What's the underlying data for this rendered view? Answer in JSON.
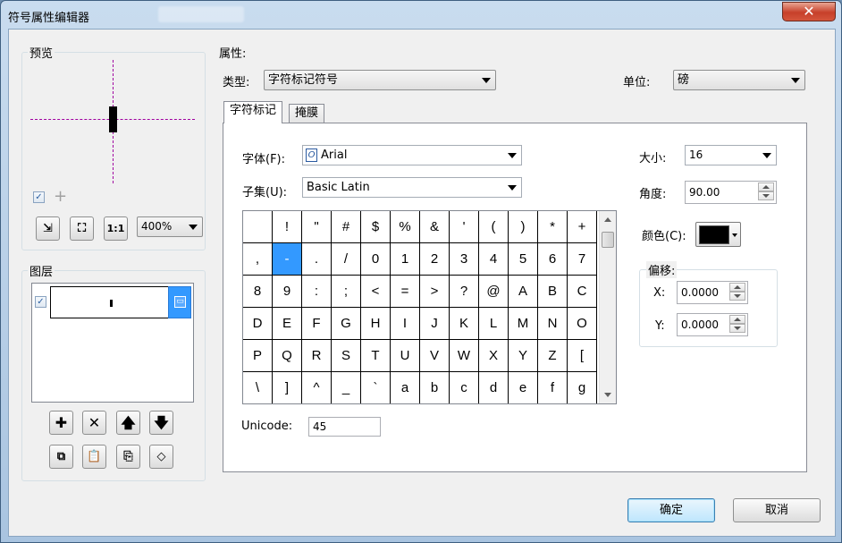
{
  "window": {
    "title": "符号属性编辑器",
    "close_glyph": "✕"
  },
  "preview": {
    "group_label": "预览",
    "show_checkbox_checked": true,
    "zoom_value": "400%",
    "buttons": [
      "zoom-to-fit-icon",
      "full-extent-icon",
      "actual-size-icon"
    ]
  },
  "layers": {
    "group_label": "图层",
    "row_checked": true,
    "action_buttons": [
      "add-icon",
      "remove-icon",
      "move-up-icon",
      "move-down-icon"
    ],
    "tool_buttons": [
      "copy-icon",
      "paste-icon",
      "reset-icon",
      "tag-icon"
    ]
  },
  "properties": {
    "group_label": "属性:",
    "type_label": "类型:",
    "type_value": "字符标记符号",
    "unit_label": "单位:",
    "unit_value": "磅",
    "tabs": [
      {
        "label": "字符标记",
        "active": true
      },
      {
        "label": "掩膜",
        "active": false
      }
    ],
    "font_label": "字体(F):",
    "font_value": "Arial",
    "subset_label": "子集(U):",
    "subset_value": "Basic Latin",
    "unicode_label": "Unicode:",
    "unicode_value": "45",
    "size_label": "大小:",
    "size_value": "16",
    "angle_label": "角度:",
    "angle_value": "90.00",
    "color_label": "颜色(C):",
    "color_value": "#000000",
    "offset_label": "偏移:",
    "x_label": "X:",
    "x_value": "0.0000",
    "y_label": "Y:",
    "y_value": "0.0000"
  },
  "char_grid": {
    "selected_index": 13,
    "chars": [
      "",
      "!",
      "\"",
      "#",
      "$",
      "%",
      "&",
      "'",
      "(",
      ")",
      "*",
      "+",
      ",",
      "-",
      ".",
      "/",
      "0",
      "1",
      "2",
      "3",
      "4",
      "5",
      "6",
      "7",
      "8",
      "9",
      ":",
      ";",
      "<",
      "=",
      ">",
      "?",
      "@",
      "A",
      "B",
      "C",
      "D",
      "E",
      "F",
      "G",
      "H",
      "I",
      "J",
      "K",
      "L",
      "M",
      "N",
      "O",
      "P",
      "Q",
      "R",
      "S",
      "T",
      "U",
      "V",
      "W",
      "X",
      "Y",
      "Z",
      "[",
      "\\",
      "]",
      "^",
      "_",
      "`",
      "a",
      "b",
      "c",
      "d",
      "e",
      "f",
      "g"
    ]
  },
  "footer": {
    "ok_label": "确定",
    "cancel_label": "取消"
  }
}
